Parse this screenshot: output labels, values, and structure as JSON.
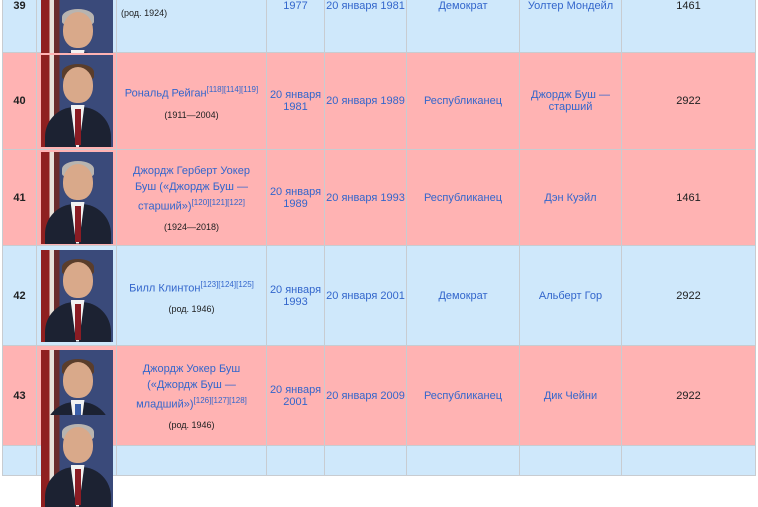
{
  "rows": [
    {
      "number": "39",
      "party_class": "dem",
      "name": "",
      "refs": "",
      "years": "(род. 1924)",
      "start": "1977",
      "end": "20 января 1981",
      "party": "Демократ",
      "vp": "Уолтер Мондейл",
      "days": "1461",
      "portrait_icon": "portrait-photo"
    },
    {
      "number": "40",
      "party_class": "rep",
      "name": "Рональд Рейган",
      "refs": "[118][114][119]",
      "years": "(1911—2004)",
      "start": "20 января 1981",
      "end": "20 января 1989",
      "party": "Республиканец",
      "vp": "Джордж Буш — старший",
      "days": "2922",
      "portrait_icon": "portrait-photo"
    },
    {
      "number": "41",
      "party_class": "rep",
      "name": "Джордж Герберт Уокер Буш («Джордж Буш — старший»)",
      "refs": "[120][121][122]",
      "years": "(1924—2018)",
      "start": "20 января 1989",
      "end": "20 января 1993",
      "party": "Республиканец",
      "vp": "Дэн Куэйл",
      "days": "1461",
      "portrait_icon": "portrait-photo"
    },
    {
      "number": "42",
      "party_class": "dem",
      "name": "Билл Клинтон",
      "refs": "[123][124][125]",
      "years": "(род. 1946)",
      "start": "20 января 1993",
      "end": "20 января 2001",
      "party": "Демократ",
      "vp": "Альберт Гор",
      "days": "2922",
      "portrait_icon": "portrait-photo"
    },
    {
      "number": "43",
      "party_class": "rep",
      "name": "Джордж Уокер Буш («Джордж Буш — младший»)",
      "refs": "[126][127][128]",
      "years": "(род. 1946)",
      "start": "20 января 2001",
      "end": "20 января 2009",
      "party": "Республиканец",
      "vp": "Дик Чейни",
      "days": "2922",
      "portrait_icon": "portrait-photo"
    },
    {
      "number": "",
      "party_class": "dem",
      "name": "",
      "refs": "",
      "years": "",
      "start": "",
      "end": "",
      "party": "",
      "vp": "",
      "days": "",
      "portrait_icon": "portrait-photo"
    }
  ]
}
